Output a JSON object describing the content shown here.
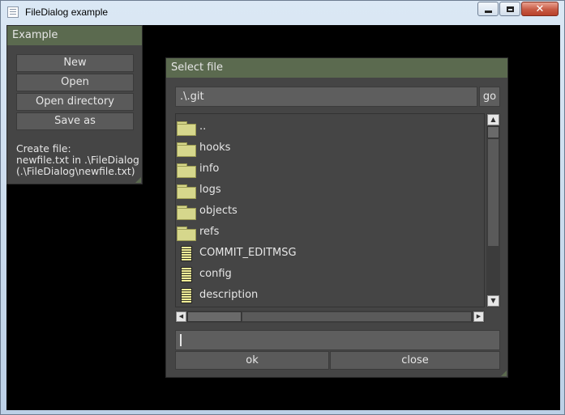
{
  "window": {
    "title": "FileDialog example"
  },
  "example_panel": {
    "title": "Example",
    "buttons": {
      "new": "New",
      "open": "Open",
      "open_directory": "Open directory",
      "save_as": "Save as"
    },
    "info_lines": [
      "Create file:",
      "newfile.txt in .\\FileDialog",
      "(.\\FileDialog\\newfile.txt)"
    ]
  },
  "dialog": {
    "title": "Select file",
    "path": ".\\.git",
    "go_label": "go",
    "entries": [
      {
        "name": "..",
        "kind": "folder"
      },
      {
        "name": "hooks",
        "kind": "folder"
      },
      {
        "name": "info",
        "kind": "folder"
      },
      {
        "name": "logs",
        "kind": "folder"
      },
      {
        "name": "objects",
        "kind": "folder"
      },
      {
        "name": "refs",
        "kind": "folder"
      },
      {
        "name": "COMMIT_EDITMSG",
        "kind": "file"
      },
      {
        "name": "config",
        "kind": "file"
      },
      {
        "name": "description",
        "kind": "file"
      }
    ],
    "filename_value": "",
    "ok_label": "ok",
    "close_label": "close"
  },
  "colors": {
    "panel_bg": "#454545",
    "header_bg": "#5b6a4f",
    "folder_icon": "#d6d78c",
    "file_icon": "#f3ef98",
    "text": "#e6e6e6"
  }
}
